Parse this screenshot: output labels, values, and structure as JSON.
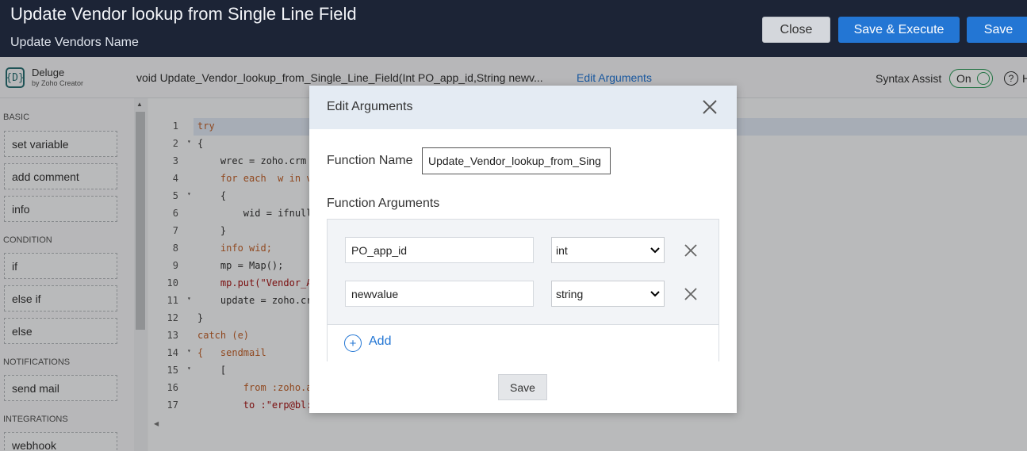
{
  "header": {
    "title": "Update Vendor lookup from Single Line Field",
    "subtitle": "Update Vendors Name",
    "close_label": "Close",
    "save_execute_label": "Save & Execute",
    "save_label": "Save"
  },
  "toolbar": {
    "logo_glyph": "{D}",
    "logo_name": "Deluge",
    "logo_sub": "by Zoho Creator",
    "signature": "void  Update_Vendor_lookup_from_Single_Line_Field(Int PO_app_id,String newv...",
    "edit_arguments_link": "Edit Arguments",
    "syntax_assist_label": "Syntax Assist",
    "syntax_assist_state": "On",
    "help_glyph": "?",
    "help_label": "H"
  },
  "sidebar": {
    "sections": [
      {
        "heading": "BASIC",
        "items": [
          "set variable",
          "add comment",
          "info"
        ]
      },
      {
        "heading": "CONDITION",
        "items": [
          "if",
          "else if",
          "else"
        ]
      },
      {
        "heading": "NOTIFICATIONS",
        "items": [
          "send mail"
        ]
      },
      {
        "heading": "INTEGRATIONS",
        "items": [
          "webhook"
        ]
      }
    ]
  },
  "editor": {
    "lines": [
      {
        "n": "1",
        "fold": "",
        "code": "try",
        "tone": "kw"
      },
      {
        "n": "2",
        "fold": "▾",
        "code": "{",
        "tone": ""
      },
      {
        "n": "3",
        "fold": "",
        "code": "    wrec = zoho.crm",
        "tone": ""
      },
      {
        "n": "4",
        "fold": "",
        "code": "    for each  w in v",
        "tone": "kw"
      },
      {
        "n": "5",
        "fold": "▾",
        "code": "    {",
        "tone": ""
      },
      {
        "n": "6",
        "fold": "",
        "code": "        wid = ifnull",
        "tone": ""
      },
      {
        "n": "7",
        "fold": "",
        "code": "    }",
        "tone": ""
      },
      {
        "n": "8",
        "fold": "",
        "code": "    info wid;",
        "tone": "kw"
      },
      {
        "n": "9",
        "fold": "",
        "code": "    mp = Map();",
        "tone": ""
      },
      {
        "n": "10",
        "fold": "",
        "code": "    mp.put(\"Vendor_A",
        "tone": "str"
      },
      {
        "n": "11",
        "fold": "▾",
        "code": "    update = zoho.cr",
        "tone": ""
      },
      {
        "n": "12",
        "fold": "",
        "code": "}",
        "tone": ""
      },
      {
        "n": "13",
        "fold": "",
        "code": "catch (e)",
        "tone": "kw"
      },
      {
        "n": "14",
        "fold": "▾",
        "code": "{   sendmail",
        "tone": "kw"
      },
      {
        "n": "15",
        "fold": "▾",
        "code": "    [",
        "tone": ""
      },
      {
        "n": "16",
        "fold": "",
        "code": "        from :zoho.a",
        "tone": "kw"
      },
      {
        "n": "17",
        "fold": "",
        "code": "        to :\"erp@bl:",
        "tone": "str"
      }
    ]
  },
  "modal": {
    "title": "Edit Arguments",
    "function_name_label": "Function Name",
    "function_name_value": "Update_Vendor_lookup_from_Sing",
    "function_arguments_label": "Function Arguments",
    "arguments": [
      {
        "name": "PO_app_id",
        "type": "int"
      },
      {
        "name": "newvalue",
        "type": "string"
      }
    ],
    "add_label": "Add",
    "add_glyph": "+",
    "save_label": "Save"
  }
}
